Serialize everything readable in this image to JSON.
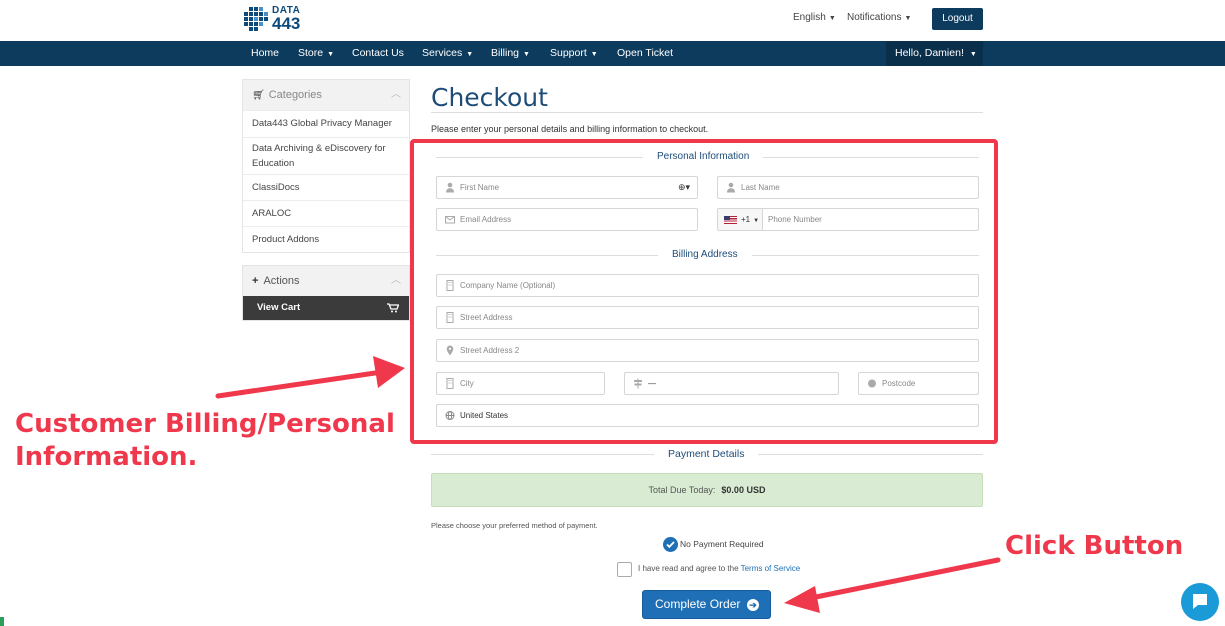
{
  "header": {
    "logo_line1": "DATA",
    "logo_line2": "443",
    "language": "English",
    "notifications": "Notifications",
    "logout": "Logout"
  },
  "nav": {
    "items": [
      "Home",
      "Store",
      "Contact Us",
      "Services",
      "Billing",
      "Support",
      "Open Ticket"
    ],
    "user": "Hello, Damien!"
  },
  "sidebar": {
    "categories_title": "Categories",
    "categories": [
      "Data443 Global Privacy Manager",
      "Data Archiving & eDiscovery for Education",
      "ClassiDocs",
      "ARALOC",
      "Product Addons"
    ],
    "actions_title": "Actions",
    "view_cart": "View Cart"
  },
  "main": {
    "title": "Checkout",
    "intro": "Please enter your personal details and billing information to checkout.",
    "personal_title": "Personal Information",
    "first_name": "First Name",
    "last_name": "Last Name",
    "email": "Email Address",
    "country_code": "+1",
    "phone": "Phone Number",
    "billing_title": "Billing Address",
    "company": "Company Name (Optional)",
    "street": "Street Address",
    "street2": "Street Address 2",
    "city": "City",
    "state": "—",
    "postcode": "Postcode",
    "country": "United States",
    "payment_title": "Payment Details",
    "total_label": "Total Due Today:",
    "total_value": "$0.00 USD",
    "choose_payment": "Please choose your preferred method of payment.",
    "no_payment": "No Payment Required",
    "tos_prefix": "I have read and agree to the",
    "tos_link": "Terms of Service",
    "complete_order": "Complete Order"
  },
  "annotations": {
    "customer": "Customer Billing/Personal Information.",
    "click": "Click Button"
  },
  "colors": {
    "brand": "#0d3b5e",
    "accent": "#1e6fb5",
    "annotation": "#f0384d",
    "total_bg": "#d9ecd3"
  }
}
